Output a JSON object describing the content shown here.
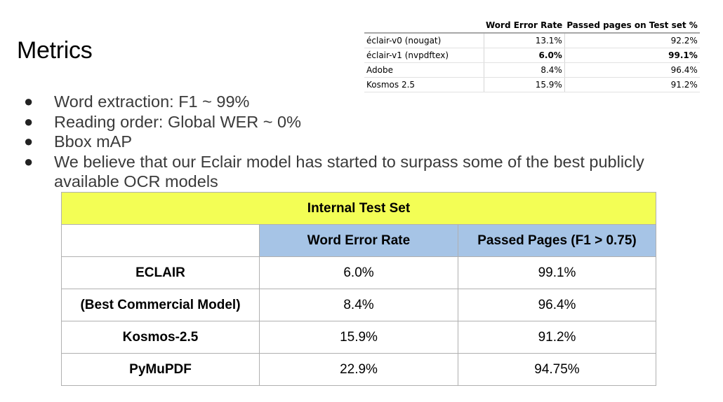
{
  "title": "Metrics",
  "small_table": {
    "headers": [
      "",
      "Word Error Rate",
      "Passed pages on Test set %"
    ],
    "rows": [
      {
        "name": "éclair-v0 (nougat)",
        "wer": "13.1%",
        "passed": "92.2%",
        "bold": false
      },
      {
        "name": "éclair-v1 (nvpdftex)",
        "wer": "6.0%",
        "passed": "99.1%",
        "bold": true
      },
      {
        "name": "Adobe",
        "wer": "8.4%",
        "passed": "96.4%",
        "bold": false
      },
      {
        "name": "Kosmos 2.5",
        "wer": "15.9%",
        "passed": "91.2%",
        "bold": false
      }
    ]
  },
  "bullets": [
    "Word extraction:  F1 ~ 99%",
    "Reading order: Global WER ~ 0%",
    "Bbox mAP",
    "We believe that our Eclair model has started to surpass some of the best publicly available OCR models"
  ],
  "main_table": {
    "title": "Internal Test Set",
    "col_headers": [
      "",
      "Word Error Rate",
      "Passed Pages (F1 > 0.75)"
    ],
    "rows": [
      {
        "label": "ECLAIR",
        "wer": "6.0%",
        "passed": "99.1%"
      },
      {
        "label": "(Best Commercial Model)",
        "wer": "8.4%",
        "passed": "96.4%"
      },
      {
        "label": "Kosmos-2.5",
        "wer": "15.9%",
        "passed": "91.2%"
      },
      {
        "label": "PyMuPDF",
        "wer": "22.9%",
        "passed": "94.75%"
      }
    ]
  },
  "colors": {
    "yellow_header": "#f3fe55",
    "blue_header": "#a6c4e6"
  }
}
